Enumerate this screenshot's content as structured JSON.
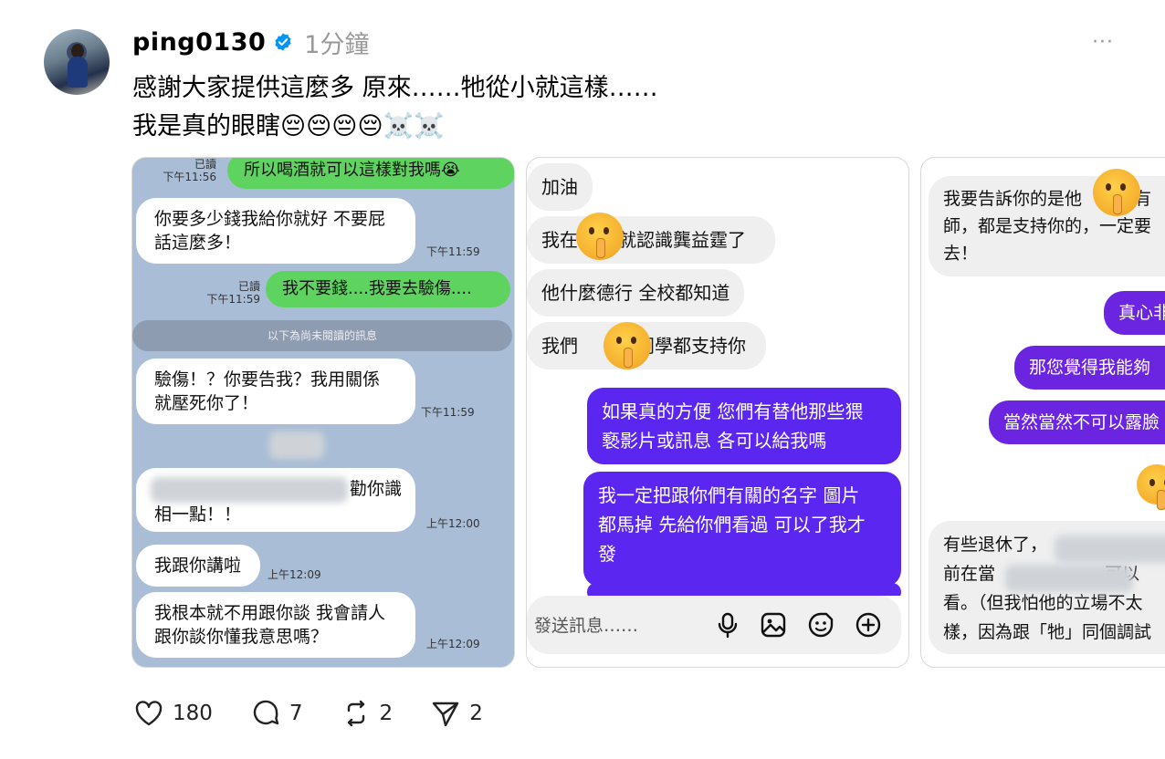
{
  "post": {
    "username": "ping0130",
    "time": "1分鐘",
    "more": "···",
    "line1": "感謝大家提供這麼多 原來……牠從小就這樣……",
    "line2": "我是真的眼瞎😔😔😔😔☠️☠️"
  },
  "shot1": {
    "top_read": "已讀",
    "top_time": "下午11:56",
    "green1": "所以喝酒就可以這樣對我嗎😭",
    "b1": "你要多少錢我給你就好 不要屁\n話這麼多！",
    "b1_time": "下午11:59",
    "read2": "已讀",
    "read2_time": "下午11:59",
    "green2": "我不要錢....我要去驗傷....",
    "divider": "以下為尚未閱讀的訊息",
    "b2": "驗傷！？你要告我？我用關係\n就壓死你了！",
    "b2_time": "下午11:59",
    "b3_tail": "勸你識",
    "b3_line2": "相一點！！",
    "b3_time": "上午12:00",
    "b4": "我跟你講啦",
    "b4_time": "上午12:09",
    "b5": "我根本就不用跟你談 我會請人\n跟你談你懂我意思嗎？",
    "b5_time": "上午12:09"
  },
  "shot2": {
    "g1": "加油",
    "g2a": "我在",
    "g2b": "就認識龔益霆了",
    "g3": "他什麼德行 全校都知道",
    "g4a": "我們",
    "g4b": "的同學都支持你",
    "p1": "如果真的方便 您們有替他那些猥\n褻影片或訊息 各可以給我嗎",
    "p2": "我一定把跟你們有關的名字 圖片\n都馬掉 先給你們看過 可以了我才\n發",
    "composer_placeholder": "發送訊息……"
  },
  "shot3": {
    "g1a": "我要告訴你的是他",
    "g1b": "所有",
    "g1c": "師，都是支持你的，一定要",
    "g1d": "去！",
    "p1": "真心非",
    "p2": "那您覺得我能夠",
    "p3": "當然當然不可以露臉",
    "g2a": "有些退休了，",
    "g2b": "前在當",
    "g2c": "可以",
    "g2d": "看。（但我怕他的立場不太",
    "g2e": "樣，因為跟「牠」同個調試"
  },
  "actions": {
    "likes": "180",
    "comments": "7",
    "reposts": "2",
    "shares": "2"
  },
  "colors": {
    "verified": "#0095f6",
    "line_green": "#5fd35f",
    "ig_purple": "#5b26f0"
  }
}
